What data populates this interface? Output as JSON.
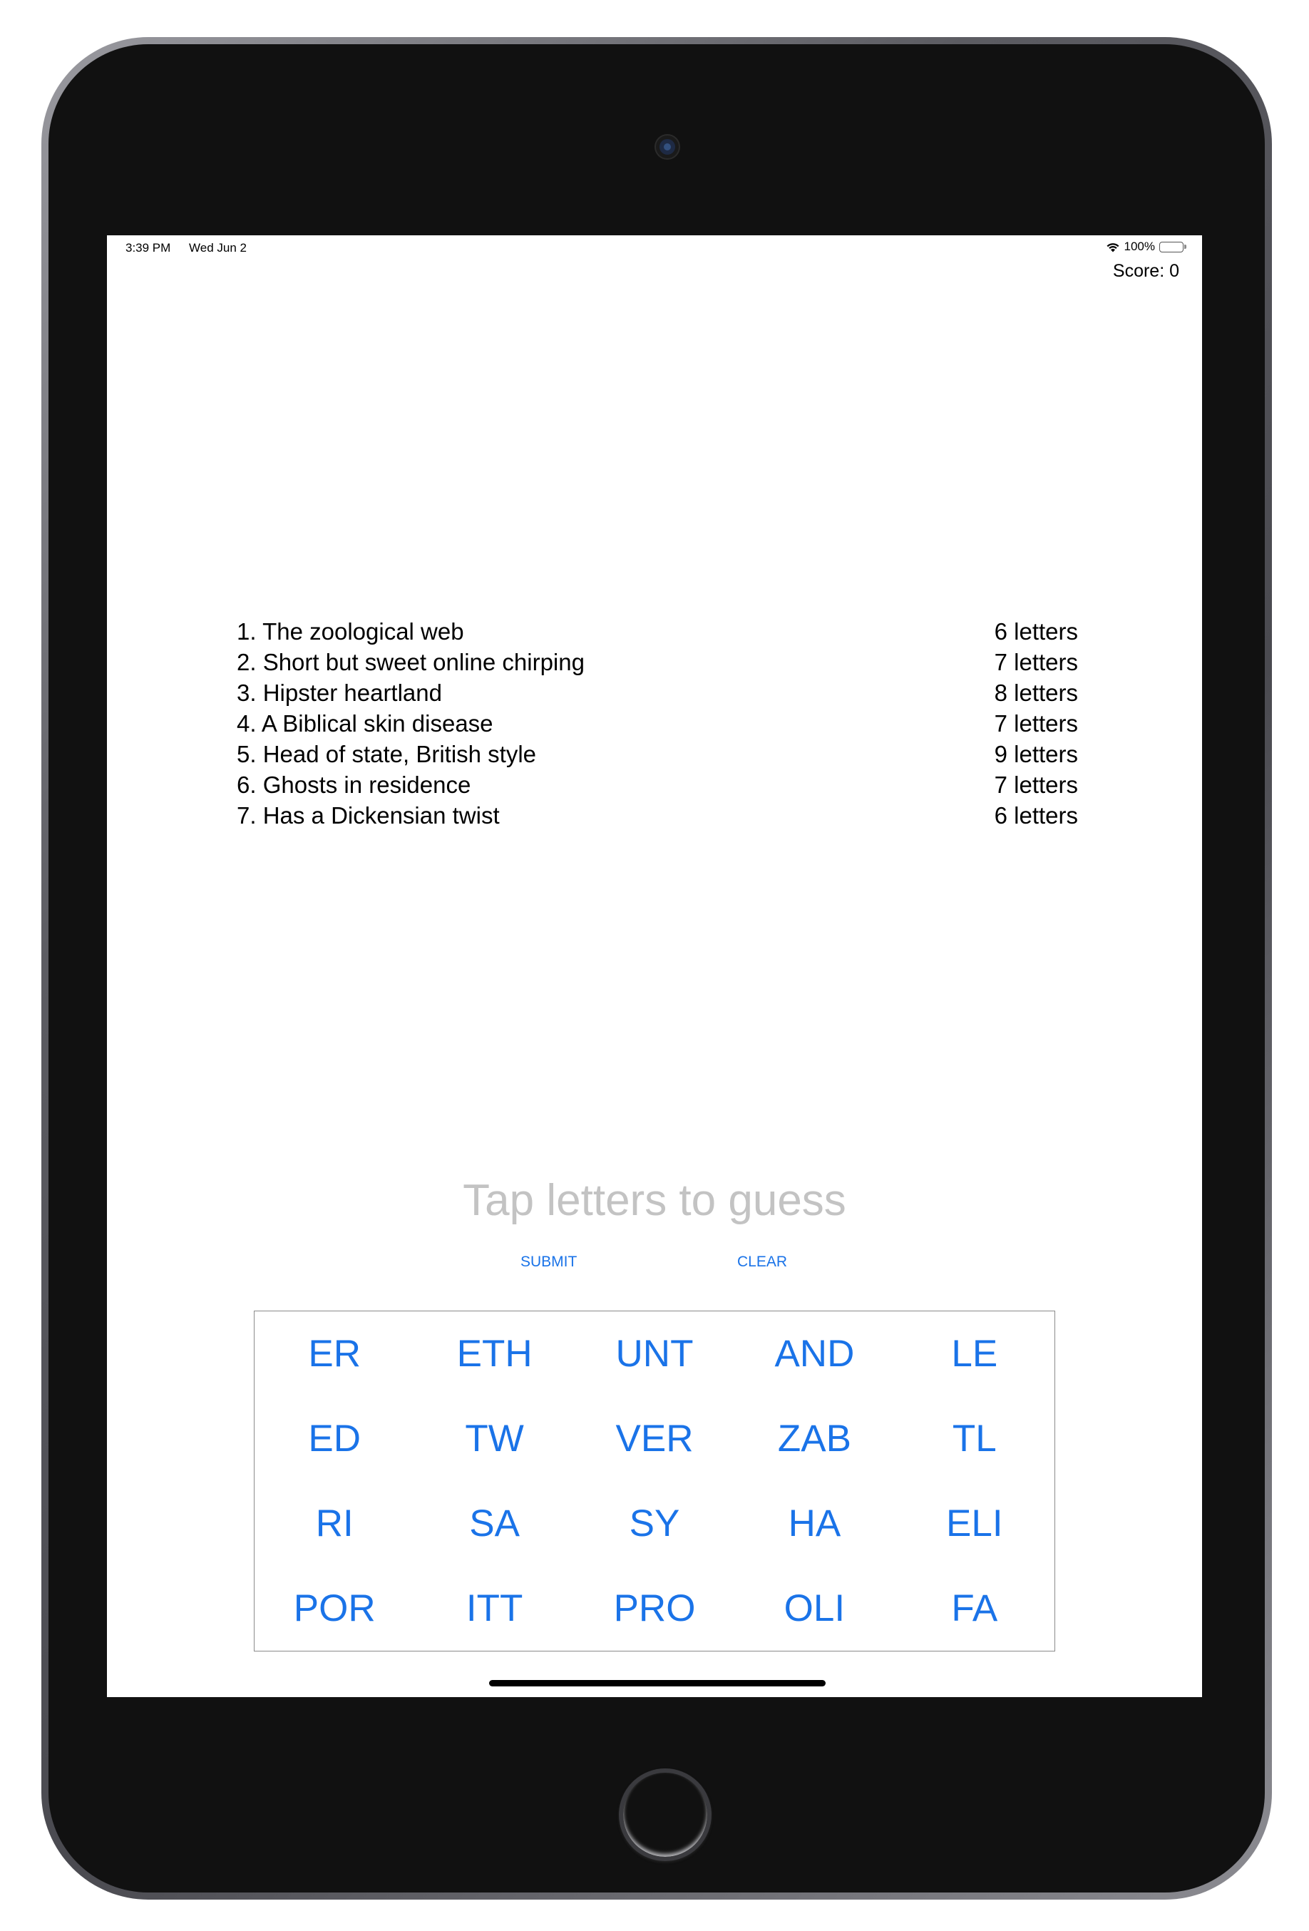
{
  "status_bar": {
    "time": "3:39 PM",
    "date": "Wed Jun 2",
    "battery": "100%",
    "battery_level": 1.0
  },
  "header": {
    "score_label": "Score: 0"
  },
  "clues": [
    {
      "clue": "1. The zoological web",
      "length": "6 letters"
    },
    {
      "clue": "2. Short but sweet online chirping",
      "length": "7 letters"
    },
    {
      "clue": "3. Hipster heartland",
      "length": "8 letters"
    },
    {
      "clue": "4. A Biblical skin disease",
      "length": "7 letters"
    },
    {
      "clue": "5. Head of state, British style",
      "length": "9 letters"
    },
    {
      "clue": "6. Ghosts in residence",
      "length": "7 letters"
    },
    {
      "clue": "7. Has a Dickensian twist",
      "length": "6 letters"
    }
  ],
  "guess": {
    "placeholder": "Tap letters to guess"
  },
  "actions": {
    "submit_label": "SUBMIT",
    "clear_label": "CLEAR"
  },
  "tiles": [
    "ER",
    "ETH",
    "UNT",
    "AND",
    "LE",
    "ED",
    "TW",
    "VER",
    "ZAB",
    "TL",
    "RI",
    "SA",
    "SY",
    "HA",
    "ELI",
    "POR",
    "ITT",
    "PRO",
    "OLI",
    "FA"
  ],
  "colors": {
    "accent": "#1a73e8",
    "placeholder": "#c3c3c3"
  },
  "icons": {
    "wifi": "wifi-icon",
    "battery": "battery-icon"
  }
}
